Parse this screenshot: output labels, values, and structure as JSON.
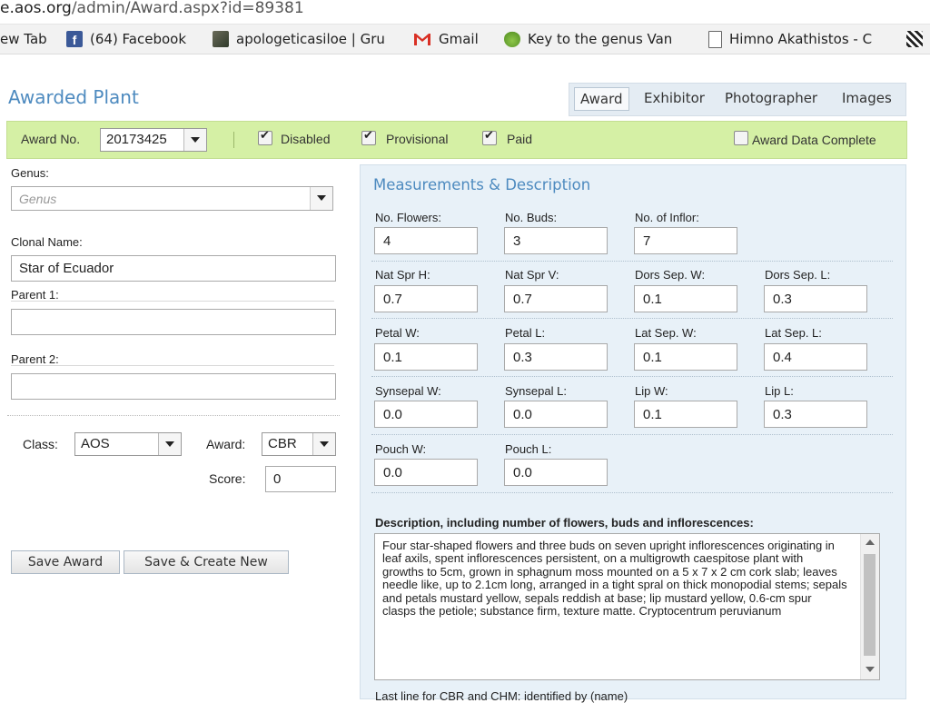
{
  "browser": {
    "url_prefix": "e.aos.org",
    "url_path": "/admin/Award.aspx?id=89381",
    "bookmarks": [
      {
        "label": "ew Tab",
        "icon": "none"
      },
      {
        "label": "(64) Facebook",
        "icon": "facebook-icon"
      },
      {
        "label": "apologeticasiloe | Gru",
        "icon": "thumbnail-icon"
      },
      {
        "label": "Gmail",
        "icon": "gmail-icon"
      },
      {
        "label": "Key to the genus Van",
        "icon": "leaf-icon"
      },
      {
        "label": "Himno Akathistos - C",
        "icon": "document-icon"
      }
    ]
  },
  "page": {
    "title": "Awarded Plant",
    "tabs": [
      {
        "label": "Award",
        "active": true
      },
      {
        "label": "Exhibitor",
        "active": false
      },
      {
        "label": "Photographer",
        "active": false
      },
      {
        "label": "Images",
        "active": false
      }
    ]
  },
  "award_bar": {
    "award_no_label": "Award No.",
    "award_no_value": "20173425",
    "disabled_label": "Disabled",
    "disabled_checked": true,
    "provisional_label": "Provisional",
    "provisional_checked": true,
    "paid_label": "Paid",
    "paid_checked": true,
    "complete_label": "Award Data Complete",
    "complete_checked": false
  },
  "left_form": {
    "genus_label": "Genus:",
    "genus_placeholder": "Genus",
    "clonal_label": "Clonal Name:",
    "clonal_value": "Star of Ecuador",
    "parent1_label": "Parent 1:",
    "parent1_value": "",
    "parent2_label": "Parent 2:",
    "parent2_value": "",
    "class_label": "Class:",
    "class_value": "AOS",
    "award_label": "Award:",
    "award_value": "CBR",
    "score_label": "Score:",
    "score_value": "0",
    "save_label": "Save Award",
    "save_new_label": "Save & Create New"
  },
  "measurements": {
    "title": "Measurements & Description",
    "fields": {
      "flowers": {
        "label": "No. Flowers:",
        "value": "4"
      },
      "buds": {
        "label": "No. Buds:",
        "value": "3"
      },
      "inflor": {
        "label": "No. of Inflor:",
        "value": "7"
      },
      "nsh": {
        "label": "Nat Spr H:",
        "value": "0.7"
      },
      "nsv": {
        "label": "Nat Spr V:",
        "value": "0.7"
      },
      "dsw": {
        "label": "Dors Sep. W:",
        "value": "0.1"
      },
      "dsl": {
        "label": "Dors Sep. L:",
        "value": "0.3"
      },
      "pw": {
        "label": "Petal W:",
        "value": "0.1"
      },
      "pl": {
        "label": "Petal L:",
        "value": "0.3"
      },
      "lsw": {
        "label": "Lat Sep. W:",
        "value": "0.1"
      },
      "lsl": {
        "label": "Lat Sep. L:",
        "value": "0.4"
      },
      "syw": {
        "label": "Synsepal W:",
        "value": "0.0"
      },
      "syl": {
        "label": "Synsepal L:",
        "value": "0.0"
      },
      "lw": {
        "label": "Lip W:",
        "value": "0.1"
      },
      "ll": {
        "label": "Lip L:",
        "value": "0.3"
      },
      "pow": {
        "label": "Pouch W:",
        "value": "0.0"
      },
      "pol": {
        "label": "Pouch L:",
        "value": "0.0"
      }
    },
    "description_label": "Description, including number of flowers, buds and inflorescences:",
    "description": "Four star-shaped flowers and three buds on seven upright inflorescences originating in leaf axils, spent inflorescences persistent, on a multigrowth caespitose plant with growths to 5cm, grown in sphagnum moss mounted on a 5 x 7 x 2 cm cork slab; leaves needle like, up to 2.1cm long, arranged in a tight spral on thick monopodial stems; sepals and petals mustard yellow, sepals reddish at base; lip mustard yellow, 0.6-cm spur clasps the petiole; substance firm, texture matte. Cryptocentrum peruvianum",
    "cut_label": "Last line for CBR and CHM: identified by (name)"
  }
}
